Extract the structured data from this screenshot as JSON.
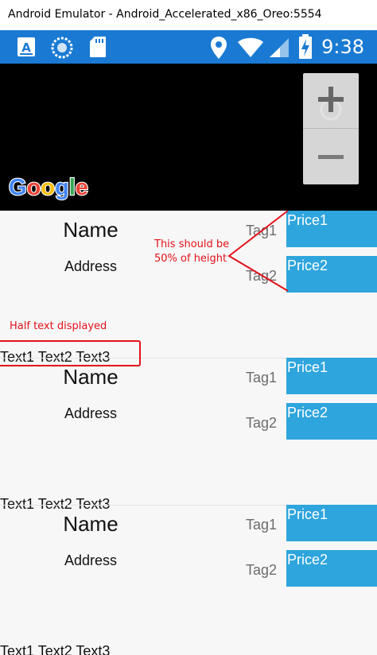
{
  "window": {
    "title": "Android Emulator - Android_Accelerated_x86_Oreo:5554"
  },
  "status_bar": {
    "time": "9:38",
    "left_icons": [
      "app-a-icon",
      "circle-app-icon",
      "sd-card-icon"
    ],
    "right_icons": [
      "location-icon",
      "wifi-icon",
      "signal-icon",
      "battery-charging-icon"
    ],
    "color": "#1a7ad3"
  },
  "map": {
    "logo_text": "Google",
    "zoom_in_symbol": "+",
    "zoom_out_symbol": "−"
  },
  "rows": [
    {
      "name": "Name",
      "address": "Address",
      "tag1": "Tag1",
      "tag2": "Tag2",
      "price1": "Price1",
      "price2": "Price2",
      "texts": "Text1  Text2  Text3"
    },
    {
      "name": "Name",
      "address": "Address",
      "tag1": "Tag1",
      "tag2": "Tag2",
      "price1": "Price1",
      "price2": "Price2",
      "texts": "Text1  Text2  Text3"
    },
    {
      "name": "Name",
      "address": "Address",
      "tag1": "Tag1",
      "tag2": "Tag2",
      "price1": "Price1",
      "price2": "Price2",
      "texts": "Text1  Text2  Text3"
    }
  ],
  "annotations": {
    "height_note": "This should be 50% of height",
    "half_text_note": "Half text displayed"
  },
  "colors": {
    "price_bg": "#2ea5dc",
    "annotation": "#e3111a"
  }
}
